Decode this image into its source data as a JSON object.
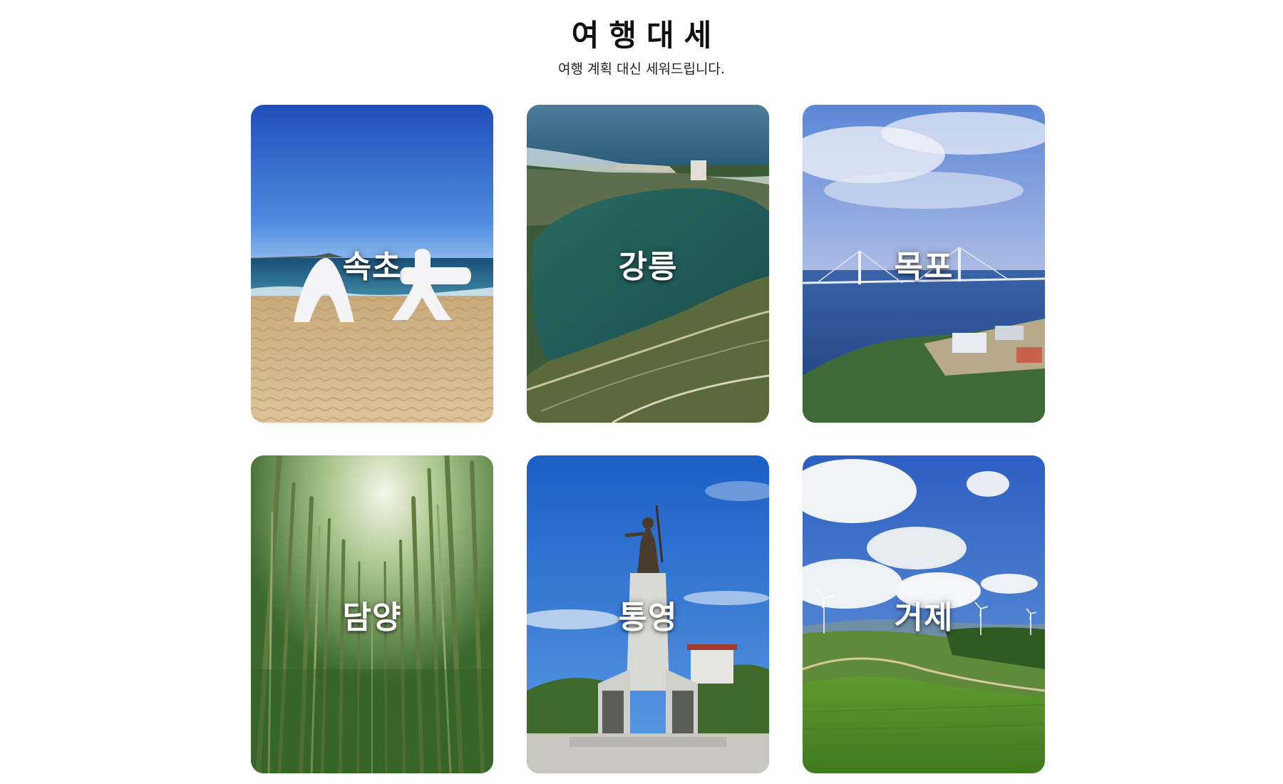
{
  "header": {
    "title": "여행대세",
    "subtitle": "여행 계획 대신 세워드립니다."
  },
  "destinations": [
    {
      "name": "속초",
      "scene": "beach-sign"
    },
    {
      "name": "강릉",
      "scene": "aerial-lake"
    },
    {
      "name": "목포",
      "scene": "bridge-harbor"
    },
    {
      "name": "담양",
      "scene": "bamboo-forest"
    },
    {
      "name": "통영",
      "scene": "statue-monument"
    },
    {
      "name": "거제",
      "scene": "hills-windmills"
    }
  ]
}
